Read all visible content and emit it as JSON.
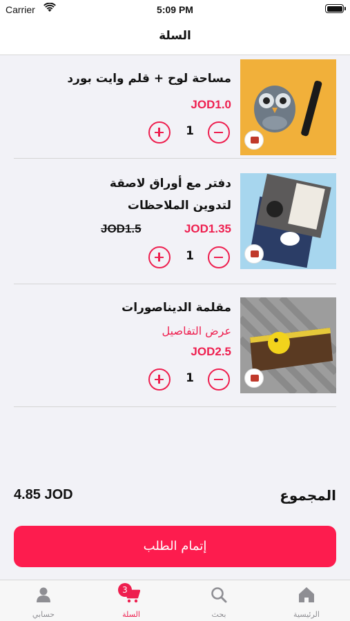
{
  "status_bar": {
    "carrier": "Carrier",
    "time": "5:09 PM"
  },
  "nav": {
    "title": "السلة"
  },
  "items": [
    {
      "name_lines": [
        "مساحة لوح + قلم وايت بورد"
      ],
      "price": "JOD1.0",
      "old_price": null,
      "details": null,
      "quantity": "1"
    },
    {
      "name_lines": [
        "دفتر مع أوراق لاصقة",
        "لتدوين الملاحظات"
      ],
      "price": "JOD1.35",
      "old_price": "JOD1.5",
      "details": null,
      "quantity": "1"
    },
    {
      "name_lines": [
        "مقلمة الديناصورات"
      ],
      "price": "JOD2.5",
      "old_price": null,
      "details": "عرض التفاصيل",
      "quantity": "1"
    }
  ],
  "summary": {
    "total_label": "المجموع",
    "total_value": "4.85 JOD"
  },
  "checkout": {
    "label": "إتمام الطلب"
  },
  "tabs": [
    {
      "label": "الرئيسية",
      "icon": "home-icon"
    },
    {
      "label": "بحث",
      "icon": "search-icon"
    },
    {
      "label": "السلة",
      "icon": "cart-icon",
      "badge": "3"
    },
    {
      "label": "حسابي",
      "icon": "person-icon"
    }
  ],
  "colors": {
    "accent": "#ee1f4f",
    "button": "#fd1c4e",
    "background": "#f2f2f7"
  }
}
